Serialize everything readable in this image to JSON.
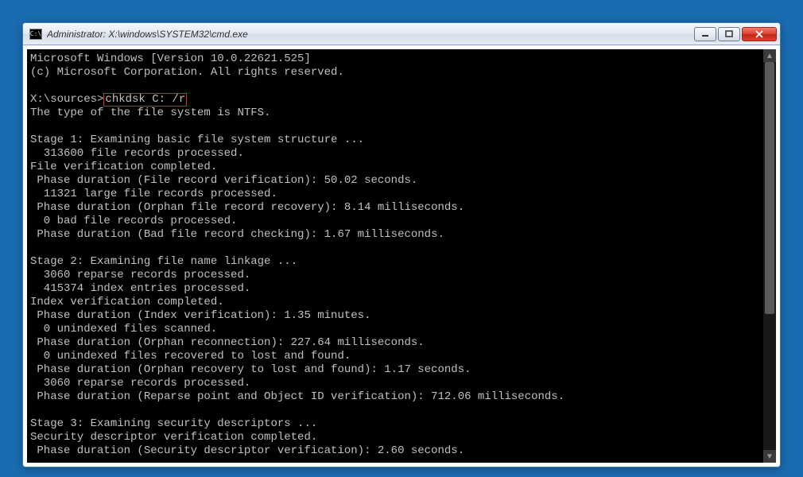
{
  "window": {
    "title": "Administrator: X:\\windows\\SYSTEM32\\cmd.exe",
    "icon_text": "C:\\"
  },
  "console": {
    "header1": "Microsoft Windows [Version 10.0.22621.525]",
    "header2": "(c) Microsoft Corporation. All rights reserved.",
    "prompt": "X:\\sources>",
    "command": "chkdsk C: /r",
    "lines": [
      "The type of the file system is NTFS.",
      "",
      "Stage 1: Examining basic file system structure ...",
      "  313600 file records processed.",
      "File verification completed.",
      " Phase duration (File record verification): 50.02 seconds.",
      "  11321 large file records processed.",
      " Phase duration (Orphan file record recovery): 8.14 milliseconds.",
      "  0 bad file records processed.",
      " Phase duration (Bad file record checking): 1.67 milliseconds.",
      "",
      "Stage 2: Examining file name linkage ...",
      "  3060 reparse records processed.",
      "  415374 index entries processed.",
      "Index verification completed.",
      " Phase duration (Index verification): 1.35 minutes.",
      "  0 unindexed files scanned.",
      " Phase duration (Orphan reconnection): 227.64 milliseconds.",
      "  0 unindexed files recovered to lost and found.",
      " Phase duration (Orphan recovery to lost and found): 1.17 seconds.",
      "  3060 reparse records processed.",
      " Phase duration (Reparse point and Object ID verification): 712.06 milliseconds.",
      "",
      "Stage 3: Examining security descriptors ...",
      "Security descriptor verification completed.",
      " Phase duration (Security descriptor verification): 2.60 seconds."
    ]
  }
}
